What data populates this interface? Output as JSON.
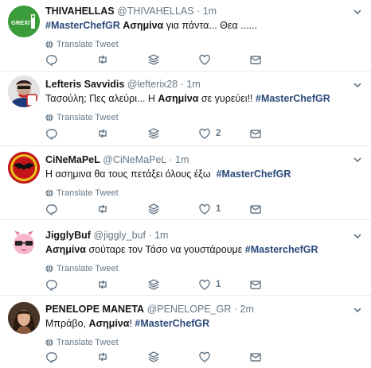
{
  "tweets": [
    {
      "name": "THIVAHELLAS",
      "handle": "@THIVAHELLAS",
      "dot": "·",
      "time": "1m",
      "text_parts": [
        {
          "t": "#MasterChefGR",
          "s": "hashtag"
        },
        {
          "t": " ",
          "s": ""
        },
        {
          "t": "Ασημίνα",
          "s": "bold"
        },
        {
          "t": " για πάντα... Θεα ......",
          "s": ""
        }
      ],
      "translate": "Translate Tweet",
      "avatar_text": "GREXIT",
      "likes": ""
    },
    {
      "name": "Lefteris Savvidis",
      "handle": "@lefterix28",
      "dot": "·",
      "time": "1m",
      "text_parts": [
        {
          "t": "Τασούλη; Πες αλεύρι... Η ",
          "s": ""
        },
        {
          "t": "Ασημίνα",
          "s": "bold"
        },
        {
          "t": " σε γυρεύει!! ",
          "s": ""
        },
        {
          "t": "#MasterChefGR",
          "s": "hashtag"
        }
      ],
      "translate": "Translate Tweet",
      "likes": "2"
    },
    {
      "name": "CiNeMaPeL",
      "handle": "@CiNeMaPeL",
      "dot": "·",
      "time": "1m",
      "text_parts": [
        {
          "t": "Η ",
          "s": ""
        },
        {
          "t": "ασημινα",
          "s": "bold"
        },
        {
          "t": " θα τους πετάξει όλους έξω  ",
          "s": ""
        },
        {
          "t": "#MasterChefGR",
          "s": "hashtag"
        }
      ],
      "translate": "Translate Tweet",
      "likes": "1"
    },
    {
      "name": "JigglyBuf",
      "handle": "@jiggly_buf",
      "dot": "·",
      "time": "1m",
      "text_parts": [
        {
          "t": "Ασημίνα",
          "s": "bold"
        },
        {
          "t": " σούταρε τον Τάσο να γουστάρουμε ",
          "s": ""
        },
        {
          "t": "#MasterchefGR",
          "s": "hashtag"
        }
      ],
      "translate": "Translate Tweet",
      "likes": "1"
    },
    {
      "name": "PENELOPE MANETA",
      "handle": "@PENELOPE_GR",
      "dot": "·",
      "time": "2m",
      "text_parts": [
        {
          "t": "Μπράβο, ",
          "s": ""
        },
        {
          "t": "Ασημίνα",
          "s": "bold"
        },
        {
          "t": "! ",
          "s": ""
        },
        {
          "t": "#MasterChefGR",
          "s": "hashtag"
        }
      ],
      "translate": "Translate Tweet",
      "likes": ""
    }
  ]
}
